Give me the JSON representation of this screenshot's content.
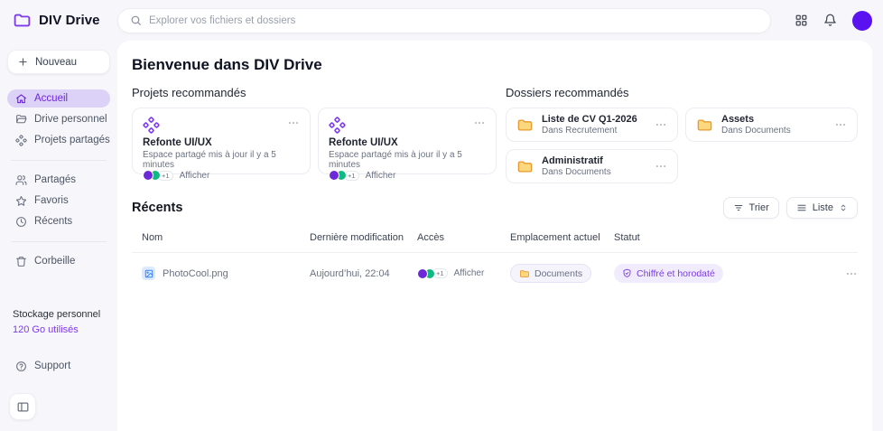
{
  "brand": {
    "name": "DIV Drive"
  },
  "search": {
    "placeholder": "Explorer vos fichiers et dossiers"
  },
  "header_icons": [
    "apps-grid-icon",
    "bell-icon",
    "user-avatar"
  ],
  "sidebar": {
    "new_label": "Nouveau",
    "nav_main": [
      {
        "label": "Accueil",
        "icon": "home-icon",
        "active": true
      },
      {
        "label": "Drive personnel",
        "icon": "folder-open-icon",
        "active": false
      },
      {
        "label": "Projets partagés",
        "icon": "nodes-icon",
        "active": false
      }
    ],
    "nav_secondary": [
      {
        "label": "Partagés",
        "icon": "people-icon"
      },
      {
        "label": "Favoris",
        "icon": "star-icon"
      },
      {
        "label": "Récents",
        "icon": "clock-icon"
      }
    ],
    "nav_trash": [
      {
        "label": "Corbeille",
        "icon": "trash-icon"
      }
    ],
    "storage": {
      "title": "Stockage personnel",
      "usage": "120 Go utilisés"
    },
    "support_label": "Support"
  },
  "main": {
    "title": "Bienvenue dans DIV Drive",
    "projects": {
      "title": "Projets recommandés",
      "cards": [
        {
          "title": "Refonte UI/UX",
          "subtitle": "Espace partagé mis à jour il y a 5 minutes",
          "extra": "+1",
          "action": "Afficher"
        },
        {
          "title": "Refonte UI/UX",
          "subtitle": "Espace partagé mis à jour il y a 5 minutes",
          "extra": "+1",
          "action": "Afficher"
        }
      ]
    },
    "folders": {
      "title": "Dossiers recommandés",
      "cards": [
        {
          "title": "Liste de CV Q1-2026",
          "subtitle": "Dans Recrutement"
        },
        {
          "title": "Assets",
          "subtitle": "Dans Documents"
        },
        {
          "title": "Administratif",
          "subtitle": "Dans Documents"
        }
      ]
    },
    "recents": {
      "title": "Récents",
      "sort_label": "Trier",
      "view_label": "Liste",
      "columns": [
        "Nom",
        "Dernière modification",
        "Accès",
        "Emplacement actuel",
        "Statut"
      ],
      "rows": [
        {
          "name": "PhotoCool.png",
          "modified": "Aujourd’hui, 22:04",
          "access_extra": "+1",
          "access_action": "Afficher",
          "location": "Documents",
          "status": "Chiffré et horodaté"
        }
      ]
    }
  },
  "colors": {
    "accent_purple": "#6d28d9",
    "avatar_purple": "#5a13f0",
    "active_pill_bg": "#dcd2f8",
    "green_avatar": "#10b981",
    "folder_amber_fill": "#fbd77e",
    "folder_amber_stroke": "#e79a2f",
    "status_pill_bg": "#f1ecfd",
    "status_pill_text": "#7c3aed",
    "page_background": "#f7f6fa",
    "file_icon_blue": "#3b82f6"
  }
}
